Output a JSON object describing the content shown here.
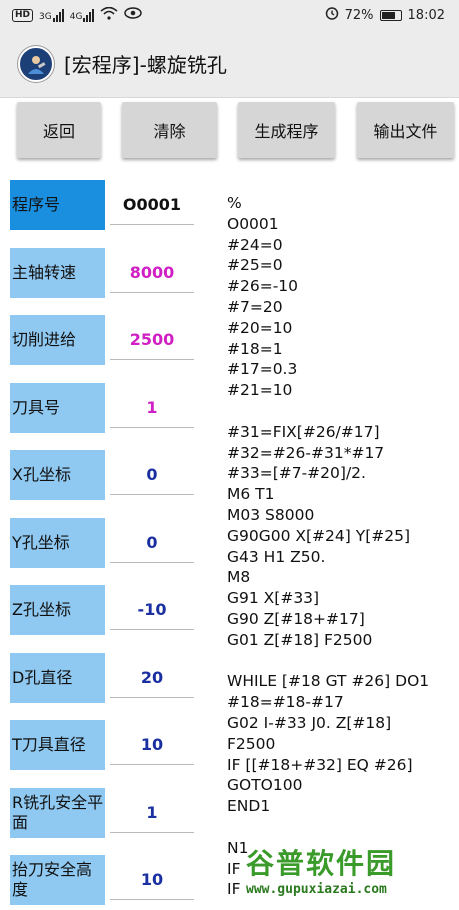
{
  "status_bar": {
    "left_badge": "HD",
    "sig1_label": "3G",
    "sig2_label": "4G",
    "battery_percent": "72%",
    "time": "18:02"
  },
  "app": {
    "title": "[宏程序]-螺旋铣孔"
  },
  "toolbar": {
    "back": "返回",
    "clear": "清除",
    "generate": "生成程序",
    "export": "输出文件"
  },
  "params": [
    {
      "label": "程序号",
      "value": "O0001"
    },
    {
      "label": "主轴转速",
      "value": "8000"
    },
    {
      "label": "切削进给",
      "value": "2500"
    },
    {
      "label": "刀具号",
      "value": "1"
    },
    {
      "label": "X孔坐标",
      "value": "0"
    },
    {
      "label": "Y孔坐标",
      "value": "0"
    },
    {
      "label": "Z孔坐标",
      "value": "-10"
    },
    {
      "label": "D孔直径",
      "value": "20"
    },
    {
      "label": "T刀具直径",
      "value": "10"
    },
    {
      "label": "R铣孔安全平面",
      "value": "1"
    },
    {
      "label": "抬刀安全高度",
      "value": "10"
    }
  ],
  "program": {
    "lines": [
      "%",
      "O0001",
      "#24=0",
      "#25=0",
      "#26=-10",
      "#7=20",
      "#20=10",
      "#18=1",
      "#17=0.3",
      "#21=10",
      "",
      "#31=FIX[#26/#17]",
      "#32=#26-#31*#17",
      "#33=[#7-#20]/2.",
      "M6 T1",
      "M03 S8000",
      "G90G00 X[#24] Y[#25]",
      "G43 H1 Z50.",
      "M8",
      "G91 X[#33]",
      "G90 Z[#18+#17]",
      "G01 Z[#18] F2500",
      "",
      "WHILE [#18 GT #26] DO1",
      "#18=#18-#17",
      "G02 I-#33 J0. Z[#18]",
      "F2500",
      "IF [[#18+#32] EQ #26]",
      "GOTO100",
      "END1",
      "",
      "N1",
      "IF",
      "IF"
    ]
  },
  "watermark": {
    "text": "谷普软件园",
    "url": "www.gupuxiazai.com"
  },
  "colors": {
    "accent": "#1a8fe0",
    "label_bg": "#8fc8f0",
    "magenta": "#d01fc4",
    "blue": "#1a2fa0"
  }
}
